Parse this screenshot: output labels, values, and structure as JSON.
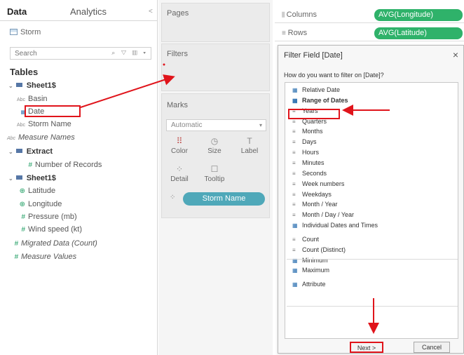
{
  "left_pane": {
    "tabs": {
      "data": "Data",
      "analytics": "Analytics",
      "collapse": "<"
    },
    "datasource": "Storm",
    "search_placeholder": "Search",
    "search_tools": "⌕ ▽ ▥ ▾",
    "tables_heading": "Tables",
    "groups": [
      {
        "name": "Sheet1$",
        "fields": [
          {
            "type": "Abc",
            "name": "Basin"
          },
          {
            "type": "date-icon",
            "name": "Date"
          },
          {
            "type": "Abc",
            "name": "Storm Name"
          }
        ]
      },
      {
        "name": "Extract",
        "fields": [
          {
            "type": "#",
            "name": "Number of Records"
          }
        ]
      },
      {
        "name": "Sheet1$",
        "fields": [
          {
            "type": "globe",
            "name": "Latitude"
          },
          {
            "type": "globe",
            "name": "Longitude"
          },
          {
            "type": "#",
            "name": "Pressure (mb)"
          },
          {
            "type": "#",
            "name": "Wind speed (kt)"
          }
        ]
      }
    ],
    "measure_names": {
      "type": "Abc",
      "name": "Measure Names"
    },
    "migrated": {
      "type": "#",
      "name": "Migrated Data (Count)"
    },
    "measure_values": {
      "type": "#",
      "name": "Measure Values"
    }
  },
  "mid_pane": {
    "pages": "Pages",
    "filters": "Filters",
    "marks": "Marks",
    "mark_type": "Automatic",
    "buttons": [
      {
        "label": "Color",
        "icon": "⠿"
      },
      {
        "label": "Size",
        "icon": "◷"
      },
      {
        "label": "Label",
        "icon": "T"
      },
      {
        "label": "Detail",
        "icon": "⁘"
      },
      {
        "label": "Tooltip",
        "icon": "☐"
      }
    ],
    "pill": "Storm Name"
  },
  "shelves": {
    "columns_label": "Columns",
    "columns_pill": "AVG(Longitude)",
    "rows_label": "Rows",
    "rows_pill": "AVG(Latitude)"
  },
  "dialog": {
    "title": "Filter Field [Date]",
    "close": "×",
    "question": "How do you want to filter on [Date]?",
    "options": [
      {
        "label": "Relative Date",
        "bold": false,
        "icon": "cal"
      },
      {
        "label": "Range of Dates",
        "bold": true,
        "icon": "cal"
      },
      {
        "label": "Years",
        "bold": false,
        "icon": "num"
      },
      {
        "label": "Quarters",
        "bold": false,
        "icon": "num"
      },
      {
        "label": "Months",
        "bold": false,
        "icon": "num"
      },
      {
        "label": "Days",
        "bold": false,
        "icon": "num"
      },
      {
        "label": "Hours",
        "bold": false,
        "icon": "num"
      },
      {
        "label": "Minutes",
        "bold": false,
        "icon": "num"
      },
      {
        "label": "Seconds",
        "bold": false,
        "icon": "num"
      },
      {
        "label": "Week numbers",
        "bold": false,
        "icon": "num"
      },
      {
        "label": "Weekdays",
        "bold": false,
        "icon": "num"
      },
      {
        "label": "Month / Year",
        "bold": false,
        "icon": "num"
      },
      {
        "label": "Month / Day / Year",
        "bold": false,
        "icon": "num"
      },
      {
        "label": "Individual Dates and Times",
        "bold": false,
        "icon": "cal"
      },
      {
        "label": "Count",
        "bold": false,
        "icon": "num"
      },
      {
        "label": "Count (Distinct)",
        "bold": false,
        "icon": "num"
      },
      {
        "label": "Minimum",
        "bold": false,
        "icon": "cal"
      },
      {
        "label": "Maximum",
        "bold": false,
        "icon": "cal"
      },
      {
        "label": "Attribute",
        "bold": false,
        "icon": "cal"
      }
    ],
    "next": "Next >",
    "cancel": "Cancel"
  },
  "colors": {
    "highlight": "#e0141b",
    "green_pill": "#2fb26a",
    "teal_pill": "#4fa8b9"
  }
}
